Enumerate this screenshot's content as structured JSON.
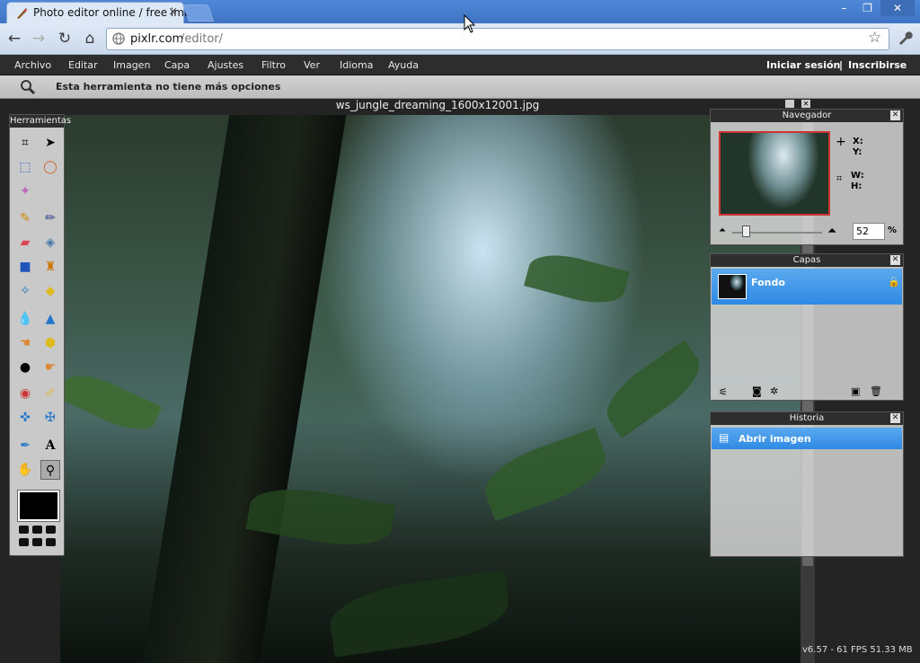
{
  "browser": {
    "tab_title": "Photo editor online / free imag",
    "tab_close": "×",
    "window_buttons": [
      "–",
      "❐",
      "✕"
    ],
    "nav": {
      "back": "←",
      "forward": "→",
      "reload": "↻",
      "home": "⌂"
    },
    "url_host": "pixlr.com",
    "url_path": "/editor/",
    "star": "☆",
    "wrench": "🔧"
  },
  "menubar": {
    "items": [
      "Archivo",
      "Editar",
      "Imagen",
      "Capa",
      "Ajustes",
      "Filtro",
      "Ver",
      "Idioma",
      "Ayuda"
    ],
    "login": "Iniciar sesión",
    "separator": "|",
    "signup": "Inscribirse"
  },
  "optionbar": {
    "text": "Esta herramienta no tiene más opciones"
  },
  "canvas": {
    "title": "ws_jungle_dreaming_1600x12001.jpg",
    "status": "v6.57 - 61 FPS 51.33 MB"
  },
  "tools": {
    "title": "Herramientas"
  },
  "navigator": {
    "title": "Navegador",
    "x_label": "X:",
    "y_label": "Y:",
    "w_label": "W:",
    "h_label": "H:",
    "zoom": "52",
    "zoom_unit": "%"
  },
  "layers": {
    "title": "Capas",
    "items": [
      {
        "name": "Fondo"
      }
    ]
  },
  "history": {
    "title": "Historia",
    "items": [
      {
        "name": "Abrir imagen"
      }
    ]
  },
  "colors": {
    "menubar": "#2d2d2d",
    "selection": "#2f8ae4",
    "chrome": "#4f88d8"
  }
}
